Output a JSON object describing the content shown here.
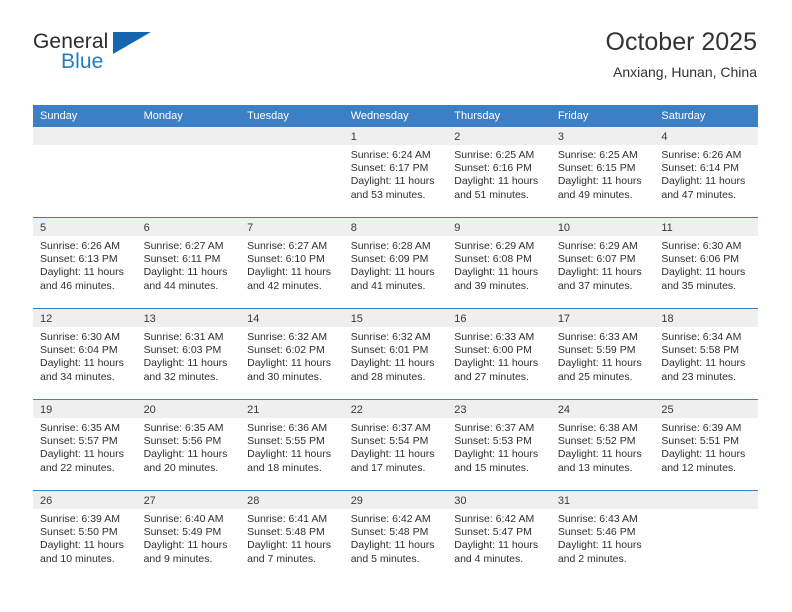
{
  "brand": {
    "name_part1": "General",
    "name_part2": "Blue",
    "triangle_color": "#1566ae",
    "blue_color": "#1f7dc4"
  },
  "header": {
    "title": "October 2025",
    "location": "Anxiang, Hunan, China"
  },
  "theme": {
    "header_row_bg": "#3b7fc4",
    "daynum_bg": "#efefef",
    "separator": "#3b7fc4",
    "text": "#2f2f2f"
  },
  "weekdays": [
    "Sunday",
    "Monday",
    "Tuesday",
    "Wednesday",
    "Thursday",
    "Friday",
    "Saturday"
  ],
  "labels": {
    "sunrise": "Sunrise:",
    "sunset": "Sunset:",
    "daylight": "Daylight:"
  },
  "weeks": [
    [
      {
        "day": "",
        "sunrise": "",
        "sunset": "",
        "daylight_line1": "",
        "daylight_line2": ""
      },
      {
        "day": "",
        "sunrise": "",
        "sunset": "",
        "daylight_line1": "",
        "daylight_line2": ""
      },
      {
        "day": "",
        "sunrise": "",
        "sunset": "",
        "daylight_line1": "",
        "daylight_line2": ""
      },
      {
        "day": "1",
        "sunrise": "Sunrise: 6:24 AM",
        "sunset": "Sunset: 6:17 PM",
        "daylight_line1": "Daylight: 11 hours",
        "daylight_line2": "and 53 minutes."
      },
      {
        "day": "2",
        "sunrise": "Sunrise: 6:25 AM",
        "sunset": "Sunset: 6:16 PM",
        "daylight_line1": "Daylight: 11 hours",
        "daylight_line2": "and 51 minutes."
      },
      {
        "day": "3",
        "sunrise": "Sunrise: 6:25 AM",
        "sunset": "Sunset: 6:15 PM",
        "daylight_line1": "Daylight: 11 hours",
        "daylight_line2": "and 49 minutes."
      },
      {
        "day": "4",
        "sunrise": "Sunrise: 6:26 AM",
        "sunset": "Sunset: 6:14 PM",
        "daylight_line1": "Daylight: 11 hours",
        "daylight_line2": "and 47 minutes."
      }
    ],
    [
      {
        "day": "5",
        "sunrise": "Sunrise: 6:26 AM",
        "sunset": "Sunset: 6:13 PM",
        "daylight_line1": "Daylight: 11 hours",
        "daylight_line2": "and 46 minutes."
      },
      {
        "day": "6",
        "sunrise": "Sunrise: 6:27 AM",
        "sunset": "Sunset: 6:11 PM",
        "daylight_line1": "Daylight: 11 hours",
        "daylight_line2": "and 44 minutes."
      },
      {
        "day": "7",
        "sunrise": "Sunrise: 6:27 AM",
        "sunset": "Sunset: 6:10 PM",
        "daylight_line1": "Daylight: 11 hours",
        "daylight_line2": "and 42 minutes."
      },
      {
        "day": "8",
        "sunrise": "Sunrise: 6:28 AM",
        "sunset": "Sunset: 6:09 PM",
        "daylight_line1": "Daylight: 11 hours",
        "daylight_line2": "and 41 minutes."
      },
      {
        "day": "9",
        "sunrise": "Sunrise: 6:29 AM",
        "sunset": "Sunset: 6:08 PM",
        "daylight_line1": "Daylight: 11 hours",
        "daylight_line2": "and 39 minutes."
      },
      {
        "day": "10",
        "sunrise": "Sunrise: 6:29 AM",
        "sunset": "Sunset: 6:07 PM",
        "daylight_line1": "Daylight: 11 hours",
        "daylight_line2": "and 37 minutes."
      },
      {
        "day": "11",
        "sunrise": "Sunrise: 6:30 AM",
        "sunset": "Sunset: 6:06 PM",
        "daylight_line1": "Daylight: 11 hours",
        "daylight_line2": "and 35 minutes."
      }
    ],
    [
      {
        "day": "12",
        "sunrise": "Sunrise: 6:30 AM",
        "sunset": "Sunset: 6:04 PM",
        "daylight_line1": "Daylight: 11 hours",
        "daylight_line2": "and 34 minutes."
      },
      {
        "day": "13",
        "sunrise": "Sunrise: 6:31 AM",
        "sunset": "Sunset: 6:03 PM",
        "daylight_line1": "Daylight: 11 hours",
        "daylight_line2": "and 32 minutes."
      },
      {
        "day": "14",
        "sunrise": "Sunrise: 6:32 AM",
        "sunset": "Sunset: 6:02 PM",
        "daylight_line1": "Daylight: 11 hours",
        "daylight_line2": "and 30 minutes."
      },
      {
        "day": "15",
        "sunrise": "Sunrise: 6:32 AM",
        "sunset": "Sunset: 6:01 PM",
        "daylight_line1": "Daylight: 11 hours",
        "daylight_line2": "and 28 minutes."
      },
      {
        "day": "16",
        "sunrise": "Sunrise: 6:33 AM",
        "sunset": "Sunset: 6:00 PM",
        "daylight_line1": "Daylight: 11 hours",
        "daylight_line2": "and 27 minutes."
      },
      {
        "day": "17",
        "sunrise": "Sunrise: 6:33 AM",
        "sunset": "Sunset: 5:59 PM",
        "daylight_line1": "Daylight: 11 hours",
        "daylight_line2": "and 25 minutes."
      },
      {
        "day": "18",
        "sunrise": "Sunrise: 6:34 AM",
        "sunset": "Sunset: 5:58 PM",
        "daylight_line1": "Daylight: 11 hours",
        "daylight_line2": "and 23 minutes."
      }
    ],
    [
      {
        "day": "19",
        "sunrise": "Sunrise: 6:35 AM",
        "sunset": "Sunset: 5:57 PM",
        "daylight_line1": "Daylight: 11 hours",
        "daylight_line2": "and 22 minutes."
      },
      {
        "day": "20",
        "sunrise": "Sunrise: 6:35 AM",
        "sunset": "Sunset: 5:56 PM",
        "daylight_line1": "Daylight: 11 hours",
        "daylight_line2": "and 20 minutes."
      },
      {
        "day": "21",
        "sunrise": "Sunrise: 6:36 AM",
        "sunset": "Sunset: 5:55 PM",
        "daylight_line1": "Daylight: 11 hours",
        "daylight_line2": "and 18 minutes."
      },
      {
        "day": "22",
        "sunrise": "Sunrise: 6:37 AM",
        "sunset": "Sunset: 5:54 PM",
        "daylight_line1": "Daylight: 11 hours",
        "daylight_line2": "and 17 minutes."
      },
      {
        "day": "23",
        "sunrise": "Sunrise: 6:37 AM",
        "sunset": "Sunset: 5:53 PM",
        "daylight_line1": "Daylight: 11 hours",
        "daylight_line2": "and 15 minutes."
      },
      {
        "day": "24",
        "sunrise": "Sunrise: 6:38 AM",
        "sunset": "Sunset: 5:52 PM",
        "daylight_line1": "Daylight: 11 hours",
        "daylight_line2": "and 13 minutes."
      },
      {
        "day": "25",
        "sunrise": "Sunrise: 6:39 AM",
        "sunset": "Sunset: 5:51 PM",
        "daylight_line1": "Daylight: 11 hours",
        "daylight_line2": "and 12 minutes."
      }
    ],
    [
      {
        "day": "26",
        "sunrise": "Sunrise: 6:39 AM",
        "sunset": "Sunset: 5:50 PM",
        "daylight_line1": "Daylight: 11 hours",
        "daylight_line2": "and 10 minutes."
      },
      {
        "day": "27",
        "sunrise": "Sunrise: 6:40 AM",
        "sunset": "Sunset: 5:49 PM",
        "daylight_line1": "Daylight: 11 hours",
        "daylight_line2": "and 9 minutes."
      },
      {
        "day": "28",
        "sunrise": "Sunrise: 6:41 AM",
        "sunset": "Sunset: 5:48 PM",
        "daylight_line1": "Daylight: 11 hours",
        "daylight_line2": "and 7 minutes."
      },
      {
        "day": "29",
        "sunrise": "Sunrise: 6:42 AM",
        "sunset": "Sunset: 5:48 PM",
        "daylight_line1": "Daylight: 11 hours",
        "daylight_line2": "and 5 minutes."
      },
      {
        "day": "30",
        "sunrise": "Sunrise: 6:42 AM",
        "sunset": "Sunset: 5:47 PM",
        "daylight_line1": "Daylight: 11 hours",
        "daylight_line2": "and 4 minutes."
      },
      {
        "day": "31",
        "sunrise": "Sunrise: 6:43 AM",
        "sunset": "Sunset: 5:46 PM",
        "daylight_line1": "Daylight: 11 hours",
        "daylight_line2": "and 2 minutes."
      },
      {
        "day": "",
        "sunrise": "",
        "sunset": "",
        "daylight_line1": "",
        "daylight_line2": ""
      }
    ]
  ]
}
